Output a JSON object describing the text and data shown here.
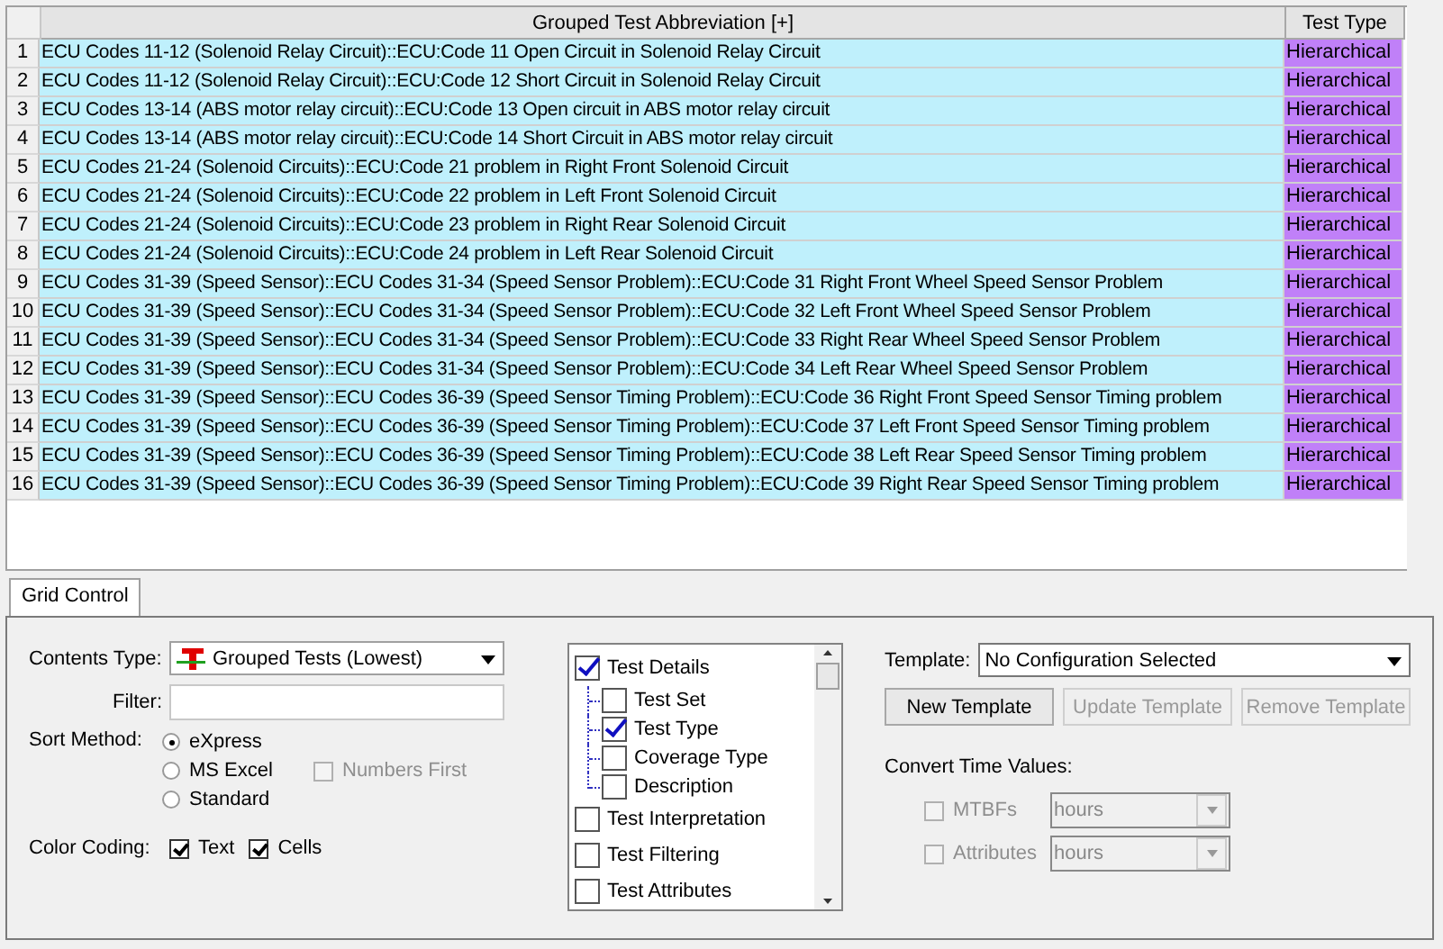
{
  "grid": {
    "columns": [
      "Grouped Test Abbreviation [+]",
      "Test Type"
    ],
    "rows": [
      {
        "number": "1",
        "abbreviation": "ECU Codes 11-12 (Solenoid Relay Circuit)::ECU:Code 11 Open Circuit in Solenoid Relay Circuit",
        "type": "Hierarchical"
      },
      {
        "number": "2",
        "abbreviation": "ECU Codes 11-12 (Solenoid Relay Circuit)::ECU:Code 12 Short Circuit in Solenoid Relay Circuit",
        "type": "Hierarchical"
      },
      {
        "number": "3",
        "abbreviation": "ECU Codes 13-14 (ABS motor relay circuit)::ECU:Code 13 Open circuit in ABS motor relay circuit",
        "type": "Hierarchical"
      },
      {
        "number": "4",
        "abbreviation": "ECU Codes 13-14 (ABS motor relay circuit)::ECU:Code 14 Short Circuit in ABS motor relay circuit",
        "type": "Hierarchical"
      },
      {
        "number": "5",
        "abbreviation": "ECU Codes 21-24 (Solenoid Circuits)::ECU:Code 21 problem in Right Front Solenoid Circuit",
        "type": "Hierarchical"
      },
      {
        "number": "6",
        "abbreviation": "ECU Codes 21-24 (Solenoid Circuits)::ECU:Code 22 problem in Left Front Solenoid Circuit",
        "type": "Hierarchical"
      },
      {
        "number": "7",
        "abbreviation": "ECU Codes 21-24 (Solenoid Circuits)::ECU:Code 23 problem in Right Rear Solenoid Circuit",
        "type": "Hierarchical"
      },
      {
        "number": "8",
        "abbreviation": "ECU Codes 21-24 (Solenoid Circuits)::ECU:Code 24 problem in Left Rear Solenoid Circuit",
        "type": "Hierarchical"
      },
      {
        "number": "9",
        "abbreviation": "ECU Codes 31-39 (Speed Sensor)::ECU Codes 31-34 (Speed Sensor Problem)::ECU:Code 31 Right Front Wheel Speed Sensor Problem",
        "type": "Hierarchical"
      },
      {
        "number": "10",
        "abbreviation": "ECU Codes 31-39 (Speed Sensor)::ECU Codes 31-34 (Speed Sensor Problem)::ECU:Code 32 Left Front Wheel Speed Sensor Problem",
        "type": "Hierarchical"
      },
      {
        "number": "11",
        "abbreviation": "ECU Codes 31-39 (Speed Sensor)::ECU Codes 31-34 (Speed Sensor Problem)::ECU:Code 33 Right Rear Wheel Speed Sensor Problem",
        "type": "Hierarchical"
      },
      {
        "number": "12",
        "abbreviation": "ECU Codes 31-39 (Speed Sensor)::ECU Codes 31-34 (Speed Sensor Problem)::ECU:Code 34 Left Rear Wheel Speed Sensor Problem",
        "type": "Hierarchical"
      },
      {
        "number": "13",
        "abbreviation": "ECU Codes 31-39 (Speed Sensor)::ECU Codes 36-39 (Speed Sensor Timing Problem)::ECU:Code 36 Right Front Speed Sensor Timing problem",
        "type": "Hierarchical"
      },
      {
        "number": "14",
        "abbreviation": "ECU Codes 31-39 (Speed Sensor)::ECU Codes 36-39 (Speed Sensor Timing Problem)::ECU:Code 37 Left Front Speed Sensor Timing problem",
        "type": "Hierarchical"
      },
      {
        "number": "15",
        "abbreviation": "ECU Codes 31-39 (Speed Sensor)::ECU Codes 36-39 (Speed Sensor Timing Problem)::ECU:Code 38 Left Rear Speed Sensor Timing problem",
        "type": "Hierarchical"
      },
      {
        "number": "16",
        "abbreviation": "ECU Codes 31-39 (Speed Sensor)::ECU Codes 36-39 (Speed Sensor Timing Problem)::ECU:Code 39 Right Rear Speed Sensor Timing problem",
        "type": "Hierarchical"
      }
    ]
  },
  "tabs": [
    {
      "label": "Grid Control",
      "selected": true
    }
  ],
  "contents_type": {
    "label": "Contents Type:",
    "value": "Grouped Tests (Lowest)"
  },
  "filter": {
    "label": "Filter:"
  },
  "sort_method": {
    "label": "Sort Method:",
    "options": [
      {
        "label": "eXpress",
        "selected": true
      },
      {
        "label": "MS Excel",
        "selected": false
      },
      {
        "label": "Standard",
        "selected": false
      }
    ],
    "numbers_first": {
      "label": "Numbers First",
      "checked": false,
      "disabled": true
    }
  },
  "color_coding": {
    "label": "Color Coding:",
    "options": [
      {
        "label": "Text",
        "checked": true
      },
      {
        "label": "Cells",
        "checked": true
      }
    ]
  },
  "columns_tree": [
    {
      "label": "Test Details",
      "checked": true,
      "children": [
        {
          "label": "Test Set",
          "checked": false
        },
        {
          "label": "Test Type",
          "checked": true
        },
        {
          "label": "Coverage Type",
          "checked": false
        },
        {
          "label": "Description",
          "checked": false
        }
      ]
    },
    {
      "label": "Test Interpretation",
      "checked": false
    },
    {
      "label": "Test Filtering",
      "checked": false
    },
    {
      "label": "Test Attributes",
      "checked": false
    }
  ],
  "template": {
    "label": "Template:",
    "value": "No Configuration Selected"
  },
  "buttons": [
    {
      "label": "New Template",
      "disabled": false
    },
    {
      "label": "Update Template",
      "disabled": true
    },
    {
      "label": "Remove Template",
      "disabled": true
    }
  ],
  "convert_time": {
    "label": "Convert Time Values:",
    "rows": [
      {
        "label": "MTBFs",
        "checked": false,
        "disabled": true,
        "unit": "hours"
      },
      {
        "label": "Attributes",
        "checked": false,
        "disabled": true,
        "unit": "hours"
      }
    ]
  }
}
